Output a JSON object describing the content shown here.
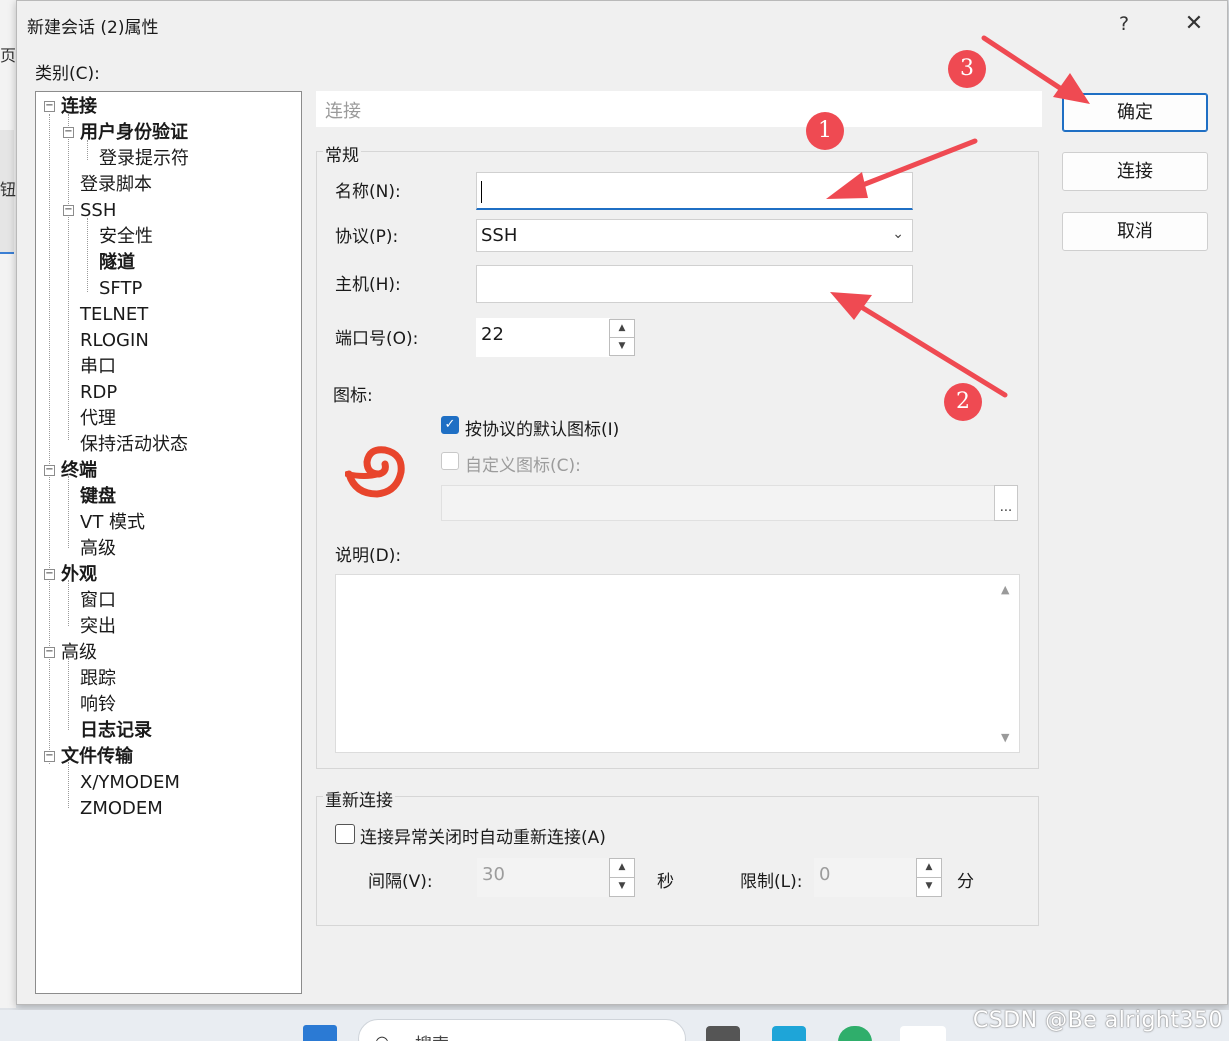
{
  "background": {
    "left_text_1": "页",
    "left_text_2": "钮"
  },
  "dialog": {
    "title": "新建会话 (2)属性",
    "help_label": "?",
    "close_label": "✕",
    "category_label": "类别(C):"
  },
  "tree": [
    {
      "label": "连接",
      "bold": true
    },
    {
      "label": "用户身份验证",
      "bold": true
    },
    {
      "label": "登录提示符",
      "bold": false
    },
    {
      "label": "登录脚本",
      "bold": false
    },
    {
      "label": "SSH",
      "bold": false
    },
    {
      "label": "安全性",
      "bold": false
    },
    {
      "label": "隧道",
      "bold": true
    },
    {
      "label": "SFTP",
      "bold": false
    },
    {
      "label": "TELNET",
      "bold": false
    },
    {
      "label": "RLOGIN",
      "bold": false
    },
    {
      "label": "串口",
      "bold": false
    },
    {
      "label": "RDP",
      "bold": false
    },
    {
      "label": "代理",
      "bold": false
    },
    {
      "label": "保持活动状态",
      "bold": false
    },
    {
      "label": "终端",
      "bold": true
    },
    {
      "label": "键盘",
      "bold": true
    },
    {
      "label": "VT 模式",
      "bold": false
    },
    {
      "label": "高级",
      "bold": false
    },
    {
      "label": "外观",
      "bold": true
    },
    {
      "label": "窗口",
      "bold": false
    },
    {
      "label": "突出",
      "bold": false
    },
    {
      "label": "高级",
      "bold": false
    },
    {
      "label": "跟踪",
      "bold": false
    },
    {
      "label": "响铃",
      "bold": false
    },
    {
      "label": "日志记录",
      "bold": true
    },
    {
      "label": "文件传输",
      "bold": true
    },
    {
      "label": "X/YMODEM",
      "bold": false
    },
    {
      "label": "ZMODEM",
      "bold": false
    }
  ],
  "panel": {
    "section_title": "连接",
    "general_label": "常规",
    "name_label": "名称(N):",
    "name_value": "",
    "protocol_label": "协议(P):",
    "protocol_value": "SSH",
    "host_label": "主机(H):",
    "host_value": "",
    "port_label": "端口号(O):",
    "port_value": "22",
    "icon_label": "图标:",
    "default_icon_label": "按协议的默认图标(I)",
    "default_icon_checked": true,
    "custom_icon_label": "自定义图标(C):",
    "custom_icon_checked": false,
    "browse_label": "...",
    "description_label": "说明(D):",
    "description_value": ""
  },
  "reconnect": {
    "group_label": "重新连接",
    "auto_label": "连接异常关闭时自动重新连接(A)",
    "auto_checked": false,
    "interval_label": "间隔(V):",
    "interval_value": "30",
    "interval_unit": "秒",
    "limit_label": "限制(L):",
    "limit_value": "0",
    "limit_unit": "分"
  },
  "buttons": {
    "ok": "确定",
    "connect": "连接",
    "cancel": "取消"
  },
  "annotations": {
    "badge_1": "1",
    "badge_2": "2",
    "badge_3": "3",
    "color": "#ef4a52"
  },
  "taskbar": {
    "search_placeholder": "搜索"
  },
  "watermark": "CSDN @Be alright350"
}
